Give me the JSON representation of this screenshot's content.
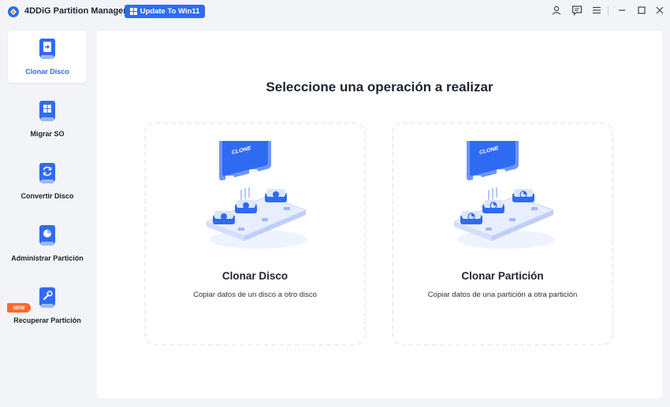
{
  "app": {
    "title": "4DDiG Partition Manager",
    "update_label": "Update To Win11",
    "accent": "#2f6bf2"
  },
  "titlebar_icons": [
    "account-icon",
    "feedback-icon",
    "menu-icon",
    "minimize-icon",
    "maximize-icon",
    "close-icon"
  ],
  "sidebar": {
    "items": [
      {
        "label": "Clonar Disco",
        "icon": "clone-disk-icon",
        "active": true
      },
      {
        "label": "Migrar SO",
        "icon": "migrate-os-icon"
      },
      {
        "label": "Convertir Disco",
        "icon": "convert-disk-icon"
      },
      {
        "label": "Administrar Partición",
        "icon": "manage-partition-icon"
      },
      {
        "label": "Recuperar Partición",
        "icon": "recover-partition-icon"
      }
    ],
    "new_badge": "NEW"
  },
  "main": {
    "title": "Seleccione una operación a realizar",
    "cards": [
      {
        "title": "Clonar Disco",
        "description": "Copiar datos de un disco a otro disco",
        "sign": "CLONE"
      },
      {
        "title": "Clonar Partición",
        "description": "Copiar datos de una partición a otra partición",
        "sign": "CLONE"
      }
    ]
  }
}
